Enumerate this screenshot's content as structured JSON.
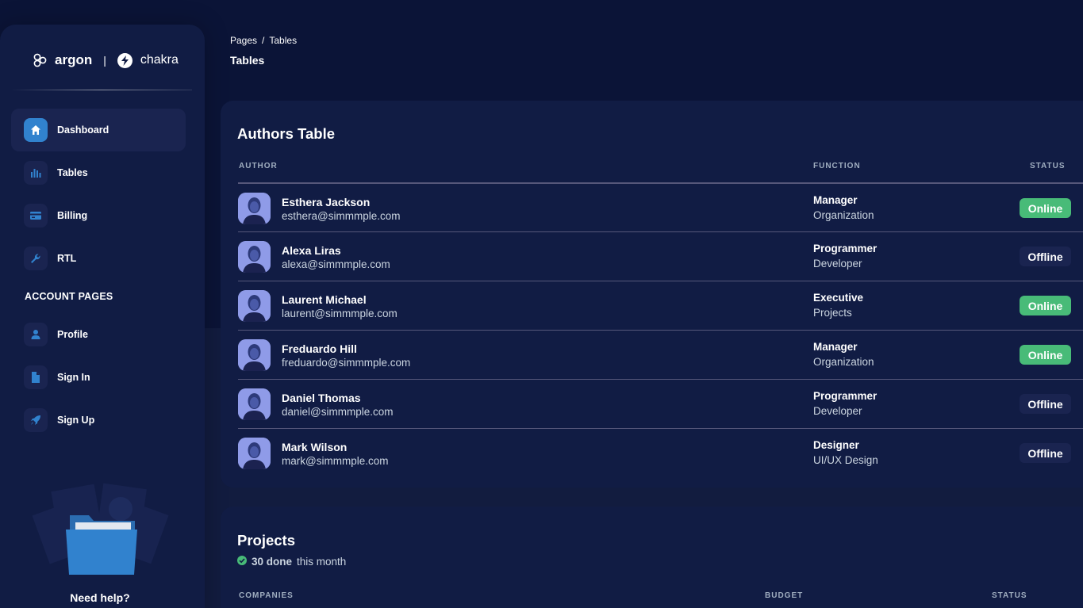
{
  "sidebar": {
    "brand": {
      "argon": "argon",
      "separator": "|",
      "chakra": "chakra"
    },
    "items": [
      {
        "label": "Dashboard",
        "icon": "home-icon",
        "active": true
      },
      {
        "label": "Tables",
        "icon": "bar-chart-icon"
      },
      {
        "label": "Billing",
        "icon": "credit-card-icon"
      },
      {
        "label": "RTL",
        "icon": "wrench-icon"
      }
    ],
    "section_title": "ACCOUNT PAGES",
    "account_items": [
      {
        "label": "Profile",
        "icon": "person-icon"
      },
      {
        "label": "Sign In",
        "icon": "document-icon"
      },
      {
        "label": "Sign Up",
        "icon": "rocket-icon"
      }
    ],
    "help_text": "Need help?"
  },
  "header": {
    "breadcrumb": {
      "root": "Pages",
      "separator": "/",
      "current": "Tables"
    },
    "title": "Tables"
  },
  "authors_table": {
    "title": "Authors Table",
    "columns": {
      "author": "AUTHOR",
      "function": "FUNCTION",
      "status": "STATUS"
    },
    "rows": [
      {
        "name": "Esthera Jackson",
        "email": "esthera@simmmple.com",
        "function": "Manager",
        "department": "Organization",
        "status": "Online"
      },
      {
        "name": "Alexa Liras",
        "email": "alexa@simmmple.com",
        "function": "Programmer",
        "department": "Developer",
        "status": "Offline"
      },
      {
        "name": "Laurent Michael",
        "email": "laurent@simmmple.com",
        "function": "Executive",
        "department": "Projects",
        "status": "Online"
      },
      {
        "name": "Freduardo Hill",
        "email": "freduardo@simmmple.com",
        "function": "Manager",
        "department": "Organization",
        "status": "Online"
      },
      {
        "name": "Daniel Thomas",
        "email": "daniel@simmmple.com",
        "function": "Programmer",
        "department": "Developer",
        "status": "Offline"
      },
      {
        "name": "Mark Wilson",
        "email": "mark@simmmple.com",
        "function": "Designer",
        "department": "UI/UX Design",
        "status": "Offline"
      }
    ]
  },
  "projects": {
    "title": "Projects",
    "done_count": "30 done",
    "done_suffix": "this month",
    "columns": {
      "companies": "COMPANIES",
      "budget": "BUDGET",
      "status": "STATUS"
    }
  },
  "colors": {
    "background": "#0b1437",
    "card": "#111c44",
    "accent": "#3182ce",
    "online": "#48bb78"
  }
}
